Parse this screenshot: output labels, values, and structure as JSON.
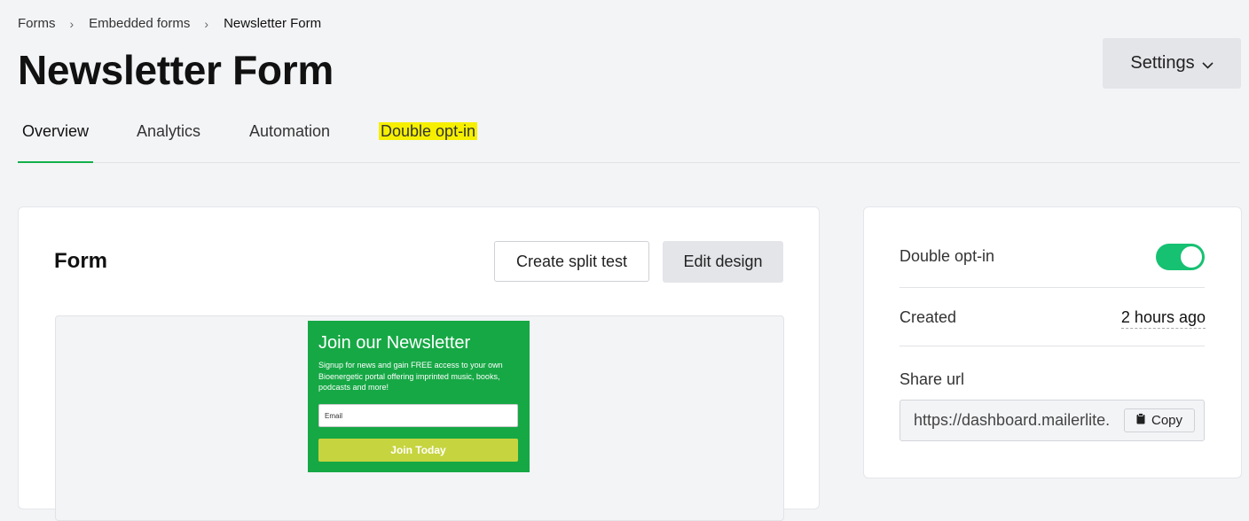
{
  "breadcrumb": {
    "items": [
      "Forms",
      "Embedded forms"
    ],
    "current": "Newsletter Form",
    "separator": "›"
  },
  "page": {
    "title": "Newsletter Form",
    "settings_label": "Settings"
  },
  "tabs": [
    {
      "label": "Overview",
      "active": true
    },
    {
      "label": "Analytics",
      "active": false
    },
    {
      "label": "Automation",
      "active": false
    },
    {
      "label": "Double opt-in",
      "active": false
    }
  ],
  "form_card": {
    "title": "Form",
    "split_test_label": "Create split test",
    "edit_design_label": "Edit design",
    "preview": {
      "heading": "Join our Newsletter",
      "description": "Signup for news and gain FREE access to your own Bioenergetic portal offering imprinted music, books, podcasts and more!",
      "email_placeholder": "Email",
      "button_label": "Join Today"
    }
  },
  "side_card": {
    "double_optin_label": "Double opt-in",
    "double_optin_enabled": true,
    "created_label": "Created",
    "created_value": "2 hours ago",
    "share_url_label": "Share url",
    "share_url_value": "https://dashboard.mailerlite.",
    "copy_label": "Copy"
  },
  "colors": {
    "accent": "#12b04a",
    "toggle_on": "#16c172",
    "preview_bg": "#16a845",
    "preview_button": "#c6d43f",
    "highlight": "#f6f000"
  }
}
